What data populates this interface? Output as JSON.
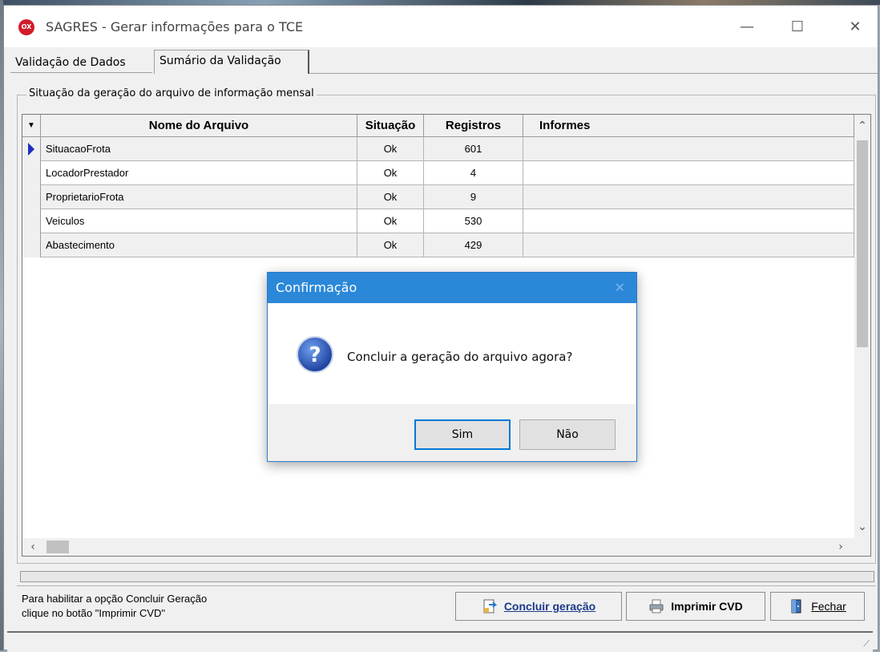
{
  "window": {
    "title": "SAGRES - Gerar informações para o TCE",
    "app_icon_text": "OX"
  },
  "tabs": [
    {
      "label": "Validação de Dados",
      "active": false
    },
    {
      "label": "Sumário da Validação",
      "active": true
    }
  ],
  "group": {
    "legend": "Situação da geração do arquivo de informação mensal"
  },
  "grid": {
    "columns": [
      "Nome do Arquivo",
      "Situação",
      "Registros",
      "Informes"
    ],
    "rows": [
      {
        "name": "SituacaoFrota",
        "situacao": "Ok",
        "registros": "601",
        "informes": ""
      },
      {
        "name": "LocadorPrestador",
        "situacao": "Ok",
        "registros": "4",
        "informes": ""
      },
      {
        "name": "ProprietarioFrota",
        "situacao": "Ok",
        "registros": "9",
        "informes": ""
      },
      {
        "name": "Veiculos",
        "situacao": "Ok",
        "registros": "530",
        "informes": ""
      },
      {
        "name": "Abastecimento",
        "situacao": "Ok",
        "registros": "429",
        "informes": ""
      }
    ]
  },
  "footer": {
    "hint_line1": "Para habilitar a opção Concluir Geração",
    "hint_line2": "clique no botão \"Imprimir CVD\"",
    "btn_concluir": "Concluir geração",
    "btn_imprimir": "Imprimir CVD",
    "btn_fechar": "Fechar"
  },
  "dialog": {
    "title": "Confirmação",
    "message": "Concluir a geração do arquivo agora?",
    "btn_yes": "Sim",
    "btn_no": "Não"
  },
  "colors": {
    "dialog_title_bg": "#2b88d8",
    "selected_indicator": "#1f2fbf"
  }
}
